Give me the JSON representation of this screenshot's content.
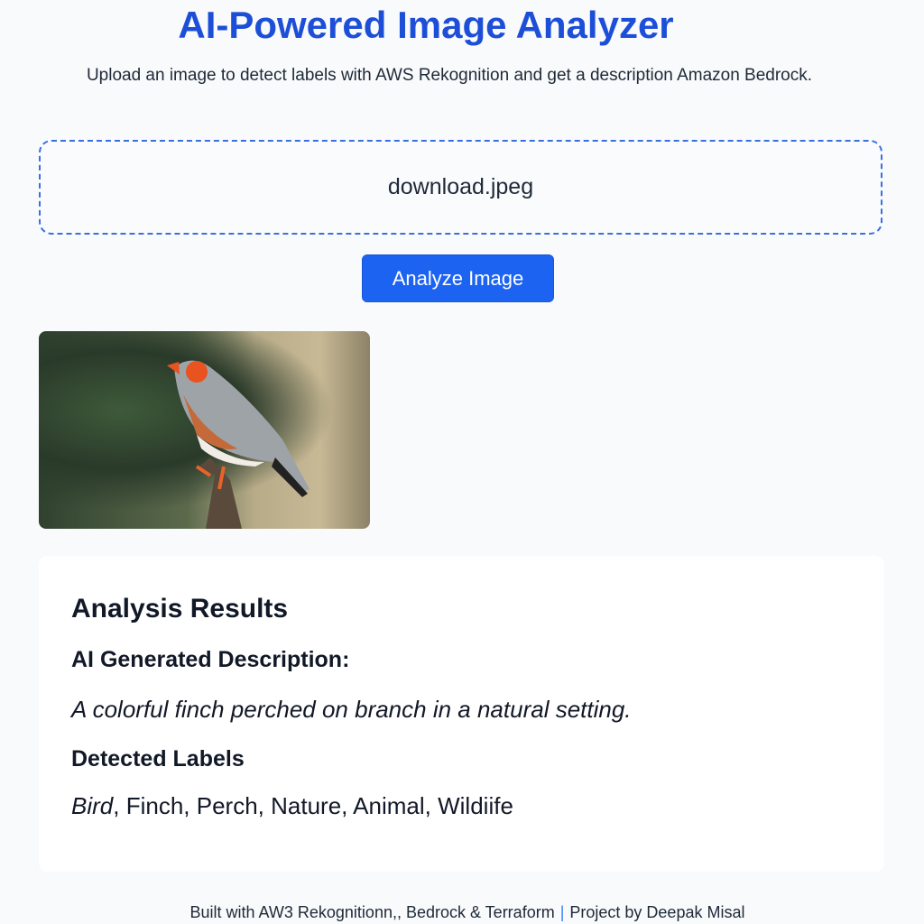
{
  "header": {
    "title": "AI-Powered Image Analyzer",
    "subtitle": "Upload an image to detect labels with AWS Rekognition and get a description Amazon Bedrock."
  },
  "upload": {
    "file_name": "download.jpeg"
  },
  "analyze_button": {
    "label": "Analyze Image",
    "color": "#1d63f2"
  },
  "preview": {
    "subject": "zebra finch perched on branch"
  },
  "results": {
    "title": "Analysis Results",
    "description_heading": "AI Generated Description:",
    "description": "A colorful finch perched on branch in a natural setting.",
    "labels_heading": "Detected Labels",
    "labels": [
      "Bird",
      "Finch",
      "Perch",
      "Nature",
      "Animal",
      "Wildiife"
    ]
  },
  "footer": {
    "left": "Built with AW3 Rekognitionn,, Bedrock & Terraform",
    "separator": "|",
    "right": "Project by Deepak Misal"
  },
  "colors": {
    "accent": "#1d4ed8"
  }
}
